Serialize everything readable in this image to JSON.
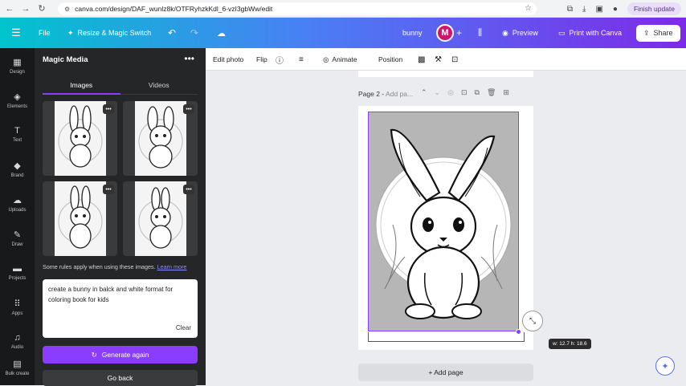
{
  "browser": {
    "url": "canva.com/design/DAF_wunlz8k/OTFRyhzkKdl_6-vzI3gbWw/edit",
    "finish_update": "Finish update"
  },
  "topbar": {
    "file": "File",
    "resize": "Resize & Magic Switch",
    "doc_title": "bunny",
    "avatar_initial": "M",
    "preview": "Preview",
    "print": "Print with Canva",
    "share": "Share"
  },
  "leftnav": {
    "items": [
      "Design",
      "Elements",
      "Text",
      "Brand",
      "Uploads",
      "Draw",
      "Projects",
      "Apps",
      "Audio",
      "Bulk create"
    ]
  },
  "panel": {
    "title": "Magic Media",
    "tabs": [
      "Images",
      "Videos"
    ],
    "rules_text": "Some rules apply when using these images.",
    "rules_link": "Learn more",
    "prompt": "create a bunny in balck and white format for coloring book for kids",
    "clear": "Clear",
    "generate_again": "Generate again",
    "go_back": "Go back"
  },
  "toolbar": {
    "edit_photo": "Edit photo",
    "flip": "Flip",
    "animate": "Animate",
    "position": "Position"
  },
  "canvas": {
    "page_label": "Page 2 -",
    "page_sub": "Add pa...",
    "size_tooltip": "w: 12.7 h: 18.6",
    "add_page": "+ Add page"
  },
  "colors": {
    "accent": "#8b3dff",
    "gradient_start": "#00c4cc",
    "gradient_end": "#7d2ae8",
    "avatar": "#d0156b"
  }
}
